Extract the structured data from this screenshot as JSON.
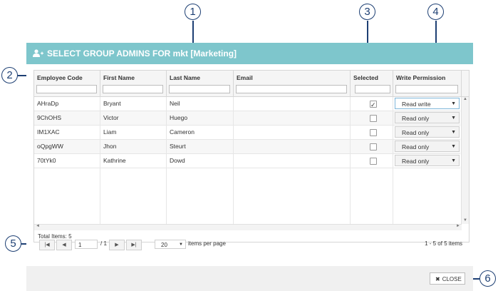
{
  "callouts": [
    "1",
    "2",
    "3",
    "4",
    "5",
    "6"
  ],
  "dialog": {
    "title": "SELECT GROUP ADMINS FOR mkt [Marketing]",
    "header_icon": "user-add-icon",
    "header_color": "#7ec6cc"
  },
  "table": {
    "columns": [
      "Employee Code",
      "First Name",
      "Last Name",
      "Email",
      "Selected",
      "Write Permission"
    ],
    "rows": [
      {
        "code": "AHraDp",
        "first": "Bryant",
        "last": "Neil",
        "email": "",
        "selected": true,
        "permission": "Read write"
      },
      {
        "code": "9ChOHS",
        "first": "Victor",
        "last": "Huego",
        "email": "",
        "selected": false,
        "permission": "Read only"
      },
      {
        "code": "IM1XAC",
        "first": "Liam",
        "last": "Cameron",
        "email": "",
        "selected": false,
        "permission": "Read only"
      },
      {
        "code": "oQpgWW",
        "first": "Jhon",
        "last": "Steurt",
        "email": "",
        "selected": false,
        "permission": "Read only"
      },
      {
        "code": "70tYk0",
        "first": "Kathrine",
        "last": "Dowd",
        "email": "",
        "selected": false,
        "permission": "Read only"
      }
    ],
    "total": "Total Items: 5"
  },
  "pager": {
    "page": "1",
    "of": "/ 1",
    "page_size": "20",
    "per_page_label": "items per page",
    "range": "1 - 5 of 5 items"
  },
  "footer": {
    "close_label": "CLOSE"
  }
}
